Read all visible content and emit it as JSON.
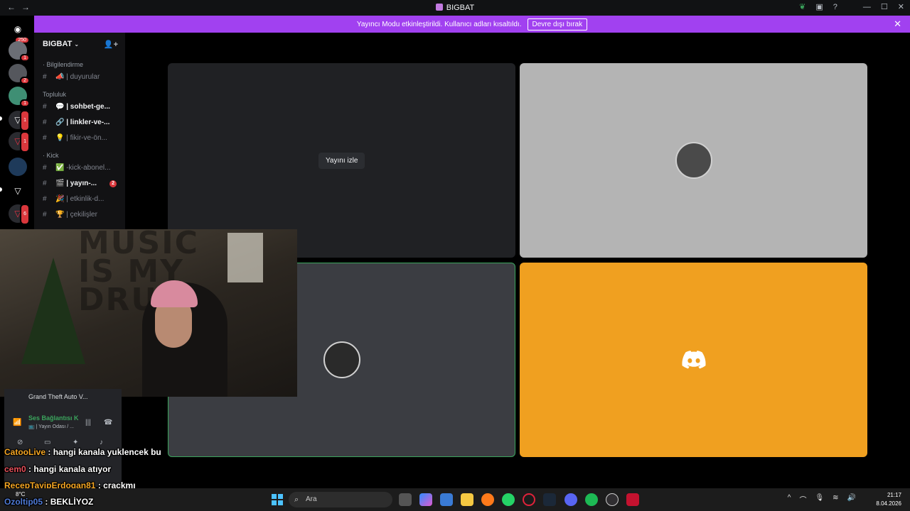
{
  "window": {
    "title": "BIGBAT",
    "back": "←",
    "forward": "→"
  },
  "banner": {
    "text": "Yayıncı Modu etkinleştirildi. Kullanıcı adları kısaltıldı.",
    "button": "Devre dışı bırak"
  },
  "server_rail": {
    "badges": [
      "250",
      "1",
      "2",
      "1",
      "1",
      "1",
      "6"
    ]
  },
  "server": {
    "name": "BIGBAT"
  },
  "categories": [
    {
      "label": "· Bilgilendirme",
      "channels": [
        {
          "name": "📣 | duyurular",
          "unread": false
        }
      ]
    },
    {
      "label": "Topluluk",
      "channels": [
        {
          "name": "💬 | sohbet-ge...",
          "unread": true
        },
        {
          "name": "🔗 | linkler-ve-...",
          "unread": true
        },
        {
          "name": "💡 | fikir-ve-ön...",
          "unread": false
        }
      ]
    },
    {
      "label": "· Kick",
      "channels": [
        {
          "name": "✅ -kick-abonel...",
          "unread": false
        },
        {
          "name": "🎬 | yayın-...",
          "unread": true,
          "mentions": "2"
        },
        {
          "name": "🎉 | etkinlik-d...",
          "unread": false
        },
        {
          "name": "🏆 | çekilişler",
          "unread": false
        }
      ]
    }
  ],
  "stage": {
    "watch_button": "Yayını izle"
  },
  "webcam": {
    "wall_text": "MUSIC IS MY DRUG"
  },
  "voice_panel": {
    "game": "Grand Theft Auto V...",
    "connection": "Ses Bağlantısı K",
    "channel": "📺 | Yayın Odası / ..."
  },
  "chat_overlay": [
    {
      "user": "CatooLive",
      "message": ": hangi kanala yuklencek bu"
    },
    {
      "user": "cem0",
      "message": ": hangi kanala atıyor"
    },
    {
      "user": "RecepTayipErdogan81",
      "message": ": crackmı"
    },
    {
      "user": "Ozoltip05",
      "message": ": BEKLİYOZ"
    }
  ],
  "taskbar": {
    "search_placeholder": "Ara",
    "weather": "8°C",
    "time": "21:17",
    "date": "8.04.2026"
  },
  "colors": {
    "banner": "#a141f0",
    "orange_tile": "#f0a020",
    "speaking": "#3ba55d"
  }
}
